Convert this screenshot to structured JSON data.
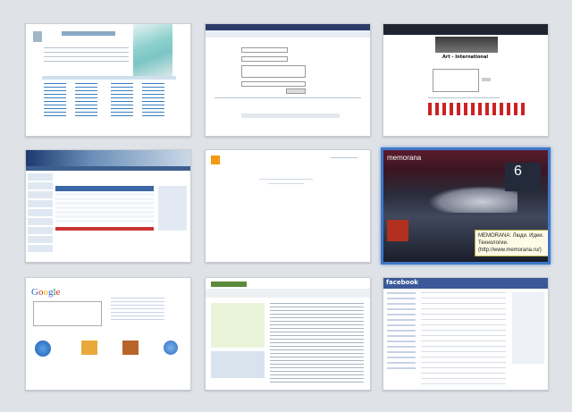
{
  "thumbnails": [
    {
      "id": "site-1",
      "selected": false
    },
    {
      "id": "site-2",
      "selected": false
    },
    {
      "id": "site-3",
      "selected": false,
      "text": "Art - International"
    },
    {
      "id": "site-4",
      "selected": false
    },
    {
      "id": "site-5",
      "selected": false
    },
    {
      "id": "site-6",
      "selected": true,
      "logo": "memorana",
      "big_number": "6",
      "caption": "MEMORANA: Люди. Идеи. Технологии. (http://www.memorana.ru/)"
    },
    {
      "id": "site-7",
      "selected": false,
      "logo": "Google"
    },
    {
      "id": "site-8",
      "selected": false
    },
    {
      "id": "site-9",
      "selected": false,
      "logo": "facebook"
    }
  ]
}
